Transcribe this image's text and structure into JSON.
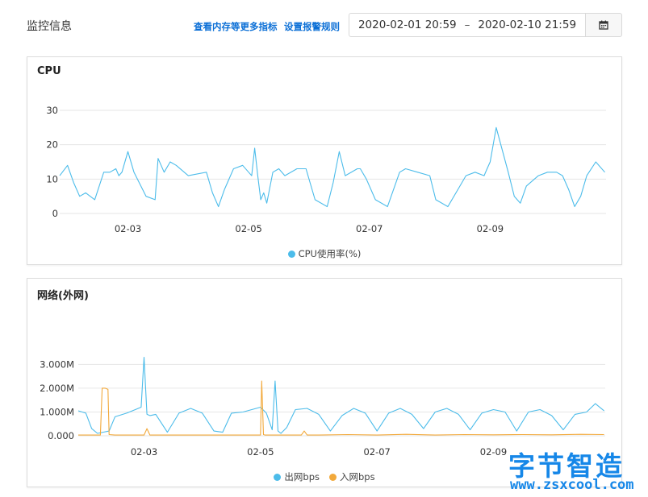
{
  "header": {
    "title": "监控信息",
    "link_more_metrics": "查看内存等更多指标",
    "link_alert_rules": "设置报警规则",
    "range_start": "2020-02-01 20:59",
    "range_sep": "–",
    "range_end": "2020-02-10 21:59",
    "calendar_icon": "calendar-icon"
  },
  "colors": {
    "out": "#4cbcea",
    "in": "#f2a93b",
    "link": "#0b6fd6"
  },
  "cpu_panel": {
    "title": "CPU",
    "legend": [
      {
        "name": "CPU使用率(%)",
        "color": "#4cbcea"
      }
    ]
  },
  "net_panel": {
    "title": "网络(外网)",
    "legend": [
      {
        "name": "出网bps",
        "color": "#4cbcea"
      },
      {
        "name": "入网bps",
        "color": "#f2a93b"
      }
    ]
  },
  "watermark": {
    "cn": "字节智造",
    "en": "www.zsxcool.com"
  },
  "chart_data": [
    {
      "type": "line",
      "title": "CPU",
      "x_range": [
        "02-01 20:59",
        "02-10 21:59"
      ],
      "x_ticks": [
        "02-03",
        "02-05",
        "02-07",
        "02-09"
      ],
      "x_tick_days": [
        3,
        5,
        7,
        9
      ],
      "y_ticks": [
        0,
        10,
        20,
        30
      ],
      "ylim": [
        0,
        30
      ],
      "grid": true,
      "legend_position": "bottom",
      "series": [
        {
          "name": "CPU使用率(%)",
          "color": "#4cbcea",
          "x_day": [
            1.87,
            2.0,
            2.1,
            2.2,
            2.3,
            2.45,
            2.6,
            2.7,
            2.8,
            2.85,
            2.9,
            3.0,
            3.1,
            3.3,
            3.45,
            3.5,
            3.6,
            3.7,
            3.8,
            4.0,
            4.3,
            4.4,
            4.5,
            4.6,
            4.75,
            4.9,
            5.0,
            5.05,
            5.1,
            5.15,
            5.2,
            5.25,
            5.3,
            5.4,
            5.5,
            5.6,
            5.8,
            5.95,
            6.1,
            6.3,
            6.4,
            6.5,
            6.6,
            6.8,
            6.85,
            6.95,
            7.1,
            7.3,
            7.5,
            7.6,
            7.8,
            8.0,
            8.1,
            8.3,
            8.5,
            8.6,
            8.75,
            8.9,
            8.95,
            9.0,
            9.1,
            9.3,
            9.4,
            9.5,
            9.6,
            9.8,
            9.95,
            10.1,
            10.2,
            10.3,
            10.4,
            10.5,
            10.6,
            10.75,
            10.9
          ],
          "values": [
            11,
            14,
            9,
            5,
            6,
            4,
            12,
            12,
            13,
            11,
            12,
            18,
            12,
            5,
            4,
            16,
            12,
            15,
            14,
            11,
            12,
            6,
            2,
            7,
            13,
            14,
            12,
            11,
            19,
            11,
            4,
            6,
            3,
            12,
            13,
            11,
            13,
            13,
            4,
            2,
            9,
            18,
            11,
            13,
            13,
            10,
            4,
            2,
            12,
            13,
            12,
            11,
            4,
            2,
            8,
            11,
            12,
            11,
            13,
            15,
            25,
            12,
            5,
            3,
            8,
            11,
            12,
            12,
            11,
            7,
            2,
            5,
            11,
            15,
            12
          ]
        }
      ]
    },
    {
      "type": "line",
      "title": "网络(外网)",
      "x_range": [
        "02-01 20:59",
        "02-10 21:59"
      ],
      "x_ticks": [
        "02-03",
        "02-05",
        "02-07",
        "02-09"
      ],
      "x_tick_days": [
        3,
        5,
        7,
        9
      ],
      "y_tick_labels": [
        "0.000",
        "1.000M",
        "2.000M",
        "3.000M"
      ],
      "ylim": [
        0,
        3.3
      ],
      "grid": true,
      "legend_position": "bottom",
      "series": [
        {
          "name": "出网bps",
          "color": "#4cbcea",
          "x_day": [
            1.87,
            2.0,
            2.1,
            2.2,
            2.4,
            2.5,
            2.7,
            2.85,
            2.95,
            3.0,
            3.05,
            3.1,
            3.2,
            3.4,
            3.6,
            3.8,
            4.0,
            4.2,
            4.35,
            4.5,
            4.7,
            4.85,
            5.0,
            5.1,
            5.2,
            5.25,
            5.3,
            5.35,
            5.45,
            5.6,
            5.8,
            6.0,
            6.2,
            6.4,
            6.6,
            6.8,
            7.0,
            7.2,
            7.4,
            7.6,
            7.8,
            8.0,
            8.2,
            8.4,
            8.6,
            8.8,
            9.0,
            9.2,
            9.4,
            9.6,
            9.8,
            10.0,
            10.2,
            10.4,
            10.6,
            10.75,
            10.9
          ],
          "values": [
            1.05,
            0.95,
            0.3,
            0.1,
            0.2,
            0.8,
            0.95,
            1.1,
            1.2,
            3.3,
            0.9,
            0.85,
            0.9,
            0.15,
            0.95,
            1.15,
            0.95,
            0.2,
            0.15,
            0.95,
            1.0,
            1.1,
            1.2,
            0.95,
            0.25,
            2.3,
            0.2,
            0.1,
            0.35,
            1.1,
            1.15,
            0.9,
            0.2,
            0.85,
            1.15,
            0.95,
            0.2,
            0.95,
            1.15,
            0.9,
            0.3,
            1.0,
            1.15,
            0.9,
            0.25,
            0.95,
            1.1,
            1.0,
            0.2,
            1.0,
            1.1,
            0.85,
            0.25,
            0.9,
            1.0,
            1.35,
            1.05
          ]
        },
        {
          "name": "入网bps",
          "color": "#f2a93b",
          "x_day": [
            1.87,
            2.1,
            2.25,
            2.28,
            2.33,
            2.38,
            2.4,
            2.5,
            2.9,
            3.0,
            3.05,
            3.1,
            3.5,
            4.0,
            4.5,
            4.95,
            5.0,
            5.02,
            5.05,
            5.08,
            5.1,
            5.2,
            5.5,
            5.7,
            5.75,
            5.8,
            6.0,
            6.5,
            7.0,
            7.5,
            8.0,
            8.5,
            9.0,
            9.5,
            10.0,
            10.5,
            10.9
          ],
          "values": [
            0.03,
            0.03,
            0.03,
            2.0,
            2.0,
            1.95,
            0.05,
            0.03,
            0.03,
            0.03,
            0.3,
            0.03,
            0.03,
            0.03,
            0.03,
            0.03,
            0.03,
            2.3,
            0.05,
            0.03,
            0.03,
            0.03,
            0.03,
            0.03,
            0.2,
            0.03,
            0.03,
            0.05,
            0.03,
            0.06,
            0.03,
            0.05,
            0.04,
            0.05,
            0.04,
            0.06,
            0.05
          ]
        }
      ]
    }
  ]
}
